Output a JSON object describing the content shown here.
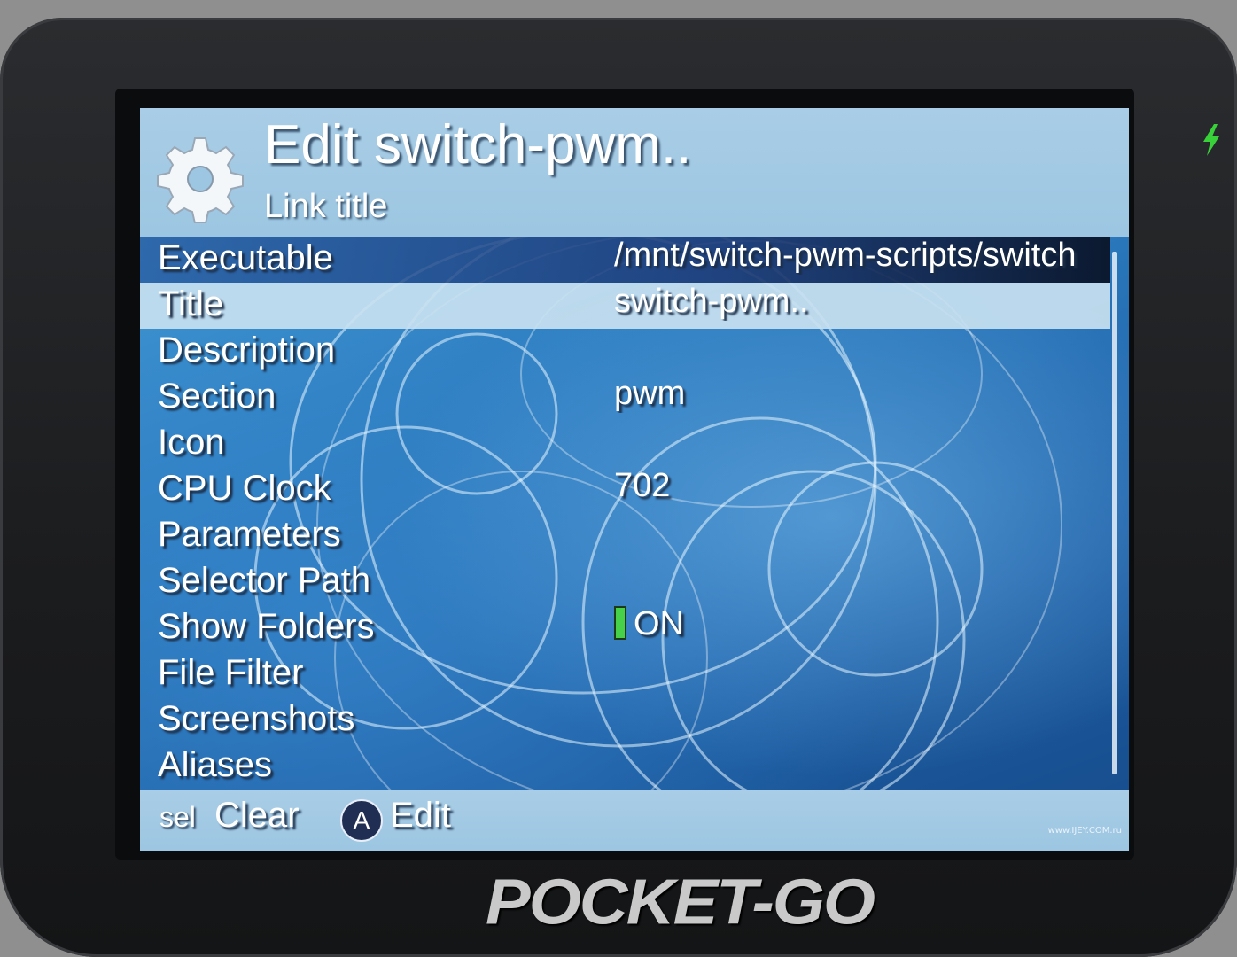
{
  "header": {
    "title": "Edit switch-pwm..",
    "subtitle": "Link title",
    "icon": "gear-icon"
  },
  "settings": [
    {
      "label": "Executable",
      "value": "/mnt/switch-pwm-scripts/switch"
    },
    {
      "label": "Title",
      "value": "switch-pwm.."
    },
    {
      "label": "Description",
      "value": ""
    },
    {
      "label": "Section",
      "value": "pwm"
    },
    {
      "label": "Icon",
      "value": ""
    },
    {
      "label": "CPU Clock",
      "value": "702"
    },
    {
      "label": "Parameters",
      "value": ""
    },
    {
      "label": "Selector Path",
      "value": ""
    },
    {
      "label": "Show Folders",
      "value": "ON"
    },
    {
      "label": "File Filter",
      "value": ""
    },
    {
      "label": "Screenshots",
      "value": ""
    },
    {
      "label": "Aliases",
      "value": ""
    }
  ],
  "footer": {
    "sel_key": "sel",
    "sel_label": "Clear",
    "a_key": "A",
    "a_label": "Edit",
    "credit": "www.IJEY.COM.ru"
  },
  "device": {
    "brand": "POCKET-GO"
  },
  "colors": {
    "toggle_on": "#47d14a",
    "charge_indicator": "#39d13a",
    "header_bg": "#a9cde6",
    "screen_bg": "#2e7fc2"
  }
}
